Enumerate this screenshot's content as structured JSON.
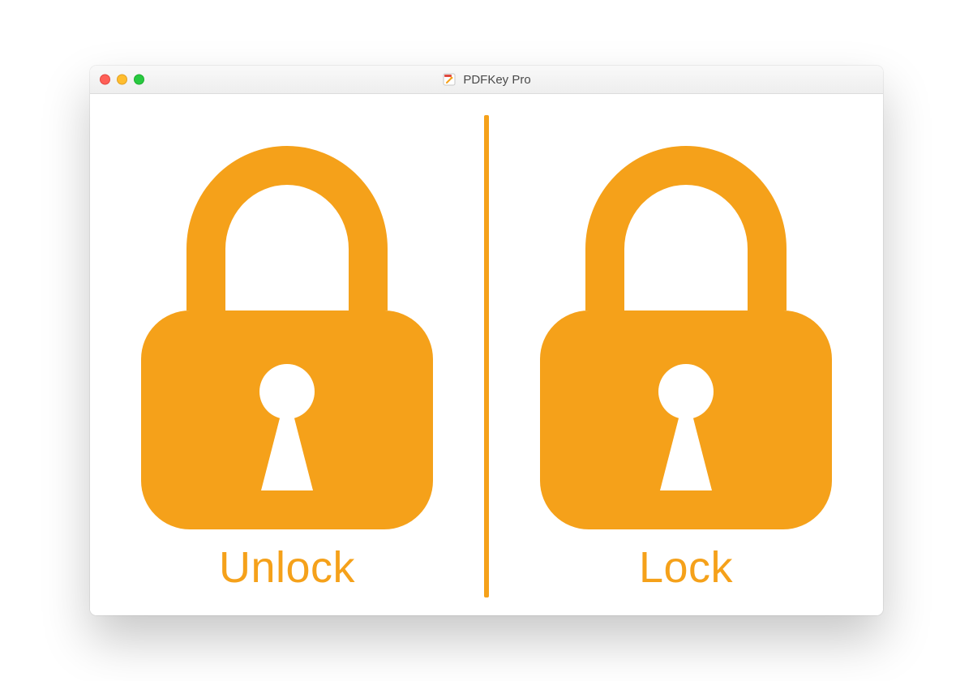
{
  "window": {
    "title": "PDFKey Pro"
  },
  "panels": {
    "unlock": {
      "label": "Unlock"
    },
    "lock": {
      "label": "Lock"
    }
  },
  "colors": {
    "accent": "#f5a11a"
  }
}
